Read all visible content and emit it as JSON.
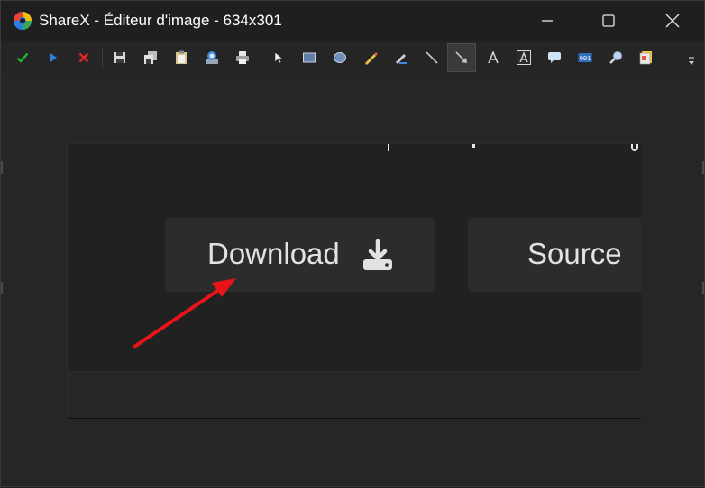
{
  "window": {
    "title": "ShareX - Éditeur d'image - 634x301"
  },
  "toolbar": {
    "groups": [
      [
        "confirm-icon",
        "upload-icon",
        "cancel-icon"
      ],
      [
        "save-icon",
        "save-as-icon",
        "copy-icon",
        "upload-image-icon",
        "print-icon"
      ],
      [
        "select-tool-icon",
        "rectangle-tool-icon",
        "ellipse-tool-icon",
        "freehand-tool-icon",
        "smart-eraser-icon",
        "line-tool-icon",
        "arrow-tool-icon",
        "text-tool-icon",
        "text-background-tool-icon",
        "speech-balloon-icon",
        "step-counter-icon",
        "magnify-tool-icon",
        "sticker-icon"
      ]
    ],
    "selected_tool": "arrow-tool-icon",
    "overflow_icon": "chevron-down-icon"
  },
  "image_content": {
    "download_label": "Download",
    "download_icon": "download-icon",
    "source_label": "Source",
    "annotation": "red-arrow",
    "annotation_color": "#e8141a"
  },
  "colors": {
    "confirm": "#1fbf2a",
    "upload": "#2f7fe0",
    "cancel": "#e02828"
  }
}
